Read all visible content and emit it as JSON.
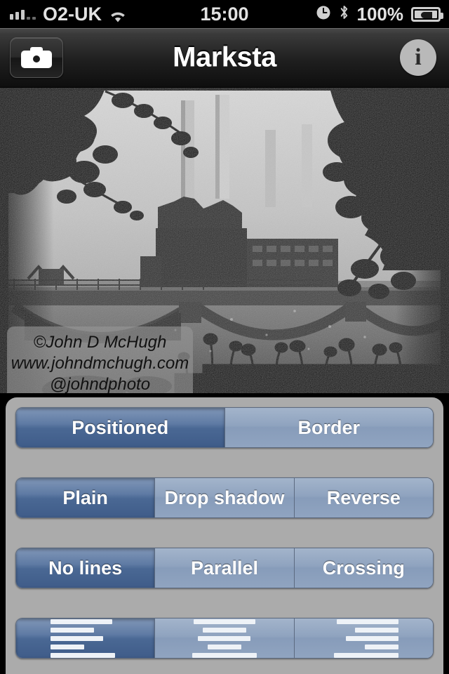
{
  "status_bar": {
    "carrier": "O2-UK",
    "time": "15:00",
    "battery_percent": "100%",
    "icons": {
      "signal": "signal-bars-icon",
      "wifi": "wifi-icon",
      "alarm": "alarm-clock-icon",
      "bluetooth": "bluetooth-icon",
      "battery": "battery-charging-icon"
    }
  },
  "nav_bar": {
    "title": "Marksta",
    "camera_button": "camera-icon",
    "info_button": "i"
  },
  "photo": {
    "description": "Black and white photograph of Battersea Power Station behind a bridge over the river, framed by tree foliage",
    "watermark": {
      "line1": "©John D McHugh",
      "line2": "www.johndmchugh.com",
      "line3": "@johndphoto"
    }
  },
  "controls": {
    "rows": [
      {
        "name": "layout-mode",
        "options": [
          {
            "label": "Positioned",
            "selected": true
          },
          {
            "label": "Border",
            "selected": false
          }
        ]
      },
      {
        "name": "text-style",
        "options": [
          {
            "label": "Plain",
            "selected": true
          },
          {
            "label": "Drop shadow",
            "selected": false
          },
          {
            "label": "Reverse",
            "selected": false
          }
        ]
      },
      {
        "name": "line-style",
        "options": [
          {
            "label": "No lines",
            "selected": true
          },
          {
            "label": "Parallel",
            "selected": false
          },
          {
            "label": "Crossing",
            "selected": false
          }
        ]
      },
      {
        "name": "text-alignment",
        "options": [
          {
            "label": "align-left-icon",
            "selected": true
          },
          {
            "label": "align-center-icon",
            "selected": false
          },
          {
            "label": "align-right-icon",
            "selected": false
          }
        ]
      }
    ]
  },
  "colors": {
    "panel_background": "#ababab",
    "segment_selected": "#4a6894",
    "segment_unselected": "#8fa3bf",
    "navbar": "#1f1f1f",
    "status_text": "#e2e2e2"
  }
}
